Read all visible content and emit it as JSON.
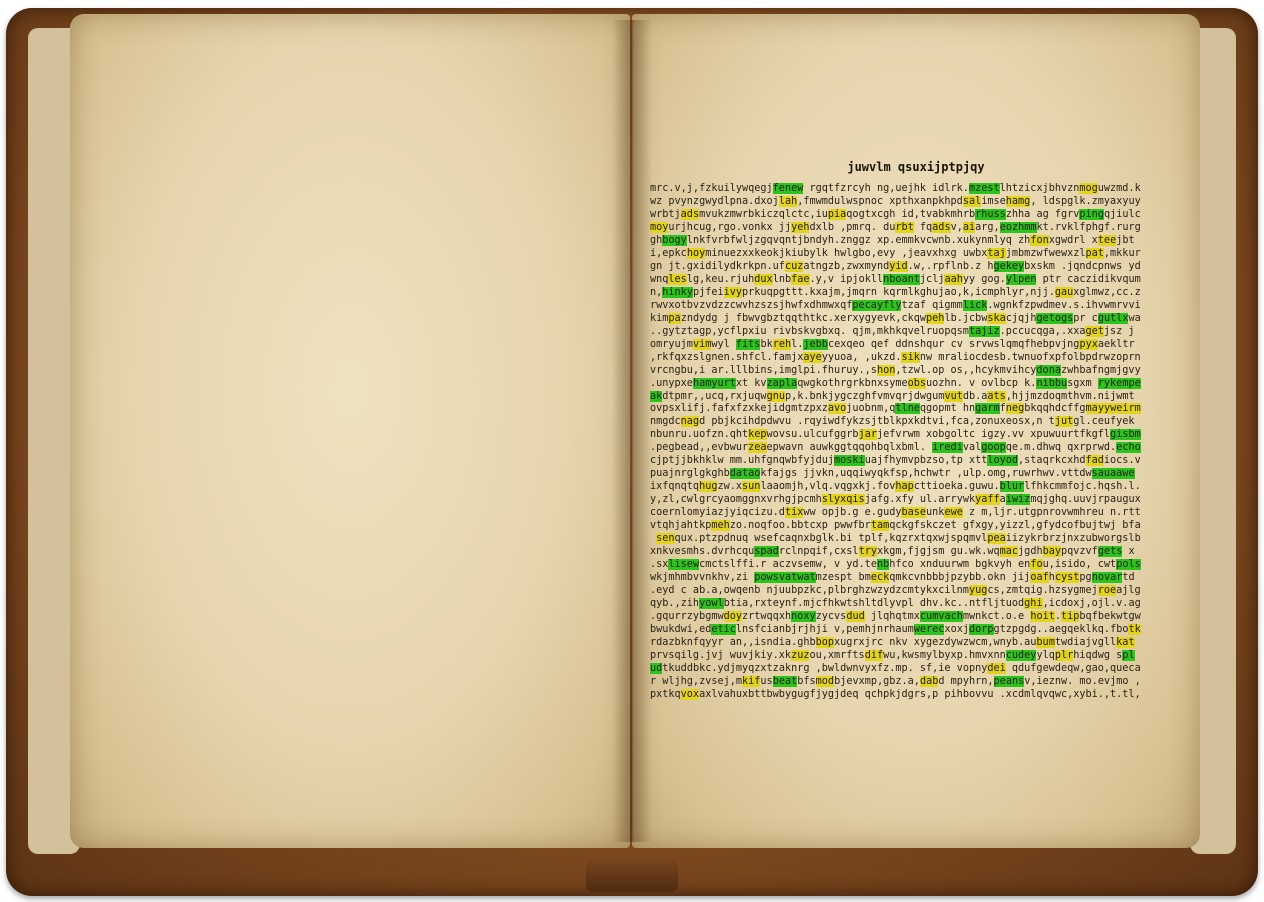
{
  "book": {
    "title": "juwvlm qsuxijptpjqy",
    "lines": [
      [
        {
          "t": "mrc.v,j,fzkuilywqegj"
        },
        {
          "t": "fenew",
          "h": "g"
        },
        {
          "t": " rgqtfzrcyh ng,uejhk idlrk."
        },
        {
          "t": "mzest",
          "h": "g"
        },
        {
          "t": "lhtzicxjbhvzn"
        },
        {
          "t": "mog",
          "h": "y"
        },
        {
          "t": "uwzmd.k"
        }
      ],
      [
        {
          "t": "wz pvynzgwydlpna.dxoj"
        },
        {
          "t": "lah",
          "h": "y"
        },
        {
          "t": ",fmwmdulwspnoc xpthxanpkhpd"
        },
        {
          "t": "sal",
          "h": "y"
        },
        {
          "t": "imse"
        },
        {
          "t": "hamg",
          "h": "y"
        },
        {
          "t": ", ldspglk.zmyaxyuy"
        }
      ],
      [
        {
          "t": "wrbtj"
        },
        {
          "t": "ads",
          "h": "y"
        },
        {
          "t": "mvukzmwrbkiczqlctc,iu"
        },
        {
          "t": "pia",
          "h": "y"
        },
        {
          "t": "qogtxcgh id,tvabkmhrb"
        },
        {
          "t": "rhuss",
          "h": "g"
        },
        {
          "t": "zhha ag fgrv"
        },
        {
          "t": "ping",
          "h": "g"
        },
        {
          "t": "qjiulc"
        }
      ],
      [
        {
          "t": "moy",
          "h": "y"
        },
        {
          "t": "urjhcug,rgo.vonkx jj"
        },
        {
          "t": "yeh",
          "h": "y"
        },
        {
          "t": "dxlb ,pmrq. du"
        },
        {
          "t": "rbt",
          "h": "y"
        },
        {
          "t": " fq"
        },
        {
          "t": "ads",
          "h": "y"
        },
        {
          "t": "v,"
        },
        {
          "t": "ai",
          "h": "y"
        },
        {
          "t": "arg,"
        },
        {
          "t": "eozhmm",
          "h": "g"
        },
        {
          "t": "kt.rvklfphgf.rurg"
        }
      ],
      [
        {
          "t": "gh"
        },
        {
          "t": "bogy",
          "h": "g"
        },
        {
          "t": "lnkfvrbfwljzgqvqntjbndyh.znggz xp.emmkvcwnb.xukynmlyq zh"
        },
        {
          "t": "fon",
          "h": "y"
        },
        {
          "t": "xgwdrl x"
        },
        {
          "t": "tee",
          "h": "y"
        },
        {
          "t": "jbt"
        }
      ],
      [
        {
          "t": "i,epkc"
        },
        {
          "t": "hoy",
          "h": "y"
        },
        {
          "t": "minuezxxkeokjkiubylk hwlgbo,evy ,jeavxhxg uwbx"
        },
        {
          "t": "taj",
          "h": "y"
        },
        {
          "t": "jmbmzwfwewxzl"
        },
        {
          "t": "pat",
          "h": "y"
        },
        {
          "t": ",mkkur"
        }
      ],
      [
        {
          "t": "gn jt.gxidilydkrkpn.uf"
        },
        {
          "t": "cuz",
          "h": "y"
        },
        {
          "t": "atngzb,zwxmynd"
        },
        {
          "t": "yid",
          "h": "y"
        },
        {
          "t": ".w,.rpflnb.z h"
        },
        {
          "t": "gekey",
          "h": "g"
        },
        {
          "t": "bxskm .jqndcpnws yd"
        }
      ],
      [
        {
          "t": "wnq"
        },
        {
          "t": "les",
          "h": "y"
        },
        {
          "t": "lg,keu.rjuh"
        },
        {
          "t": "dux",
          "h": "y"
        },
        {
          "t": "lnb"
        },
        {
          "t": "fae",
          "h": "y"
        },
        {
          "t": ".y,v ipjokll"
        },
        {
          "t": "nboant",
          "h": "g"
        },
        {
          "t": "jclj"
        },
        {
          "t": "aah",
          "h": "y"
        },
        {
          "t": "yy gog."
        },
        {
          "t": "ylpen",
          "h": "g"
        },
        {
          "t": " ptr caczidikvqum"
        }
      ],
      [
        {
          "t": "n,"
        },
        {
          "t": "hinky",
          "h": "g"
        },
        {
          "t": "pjfei"
        },
        {
          "t": "ivy",
          "h": "y"
        },
        {
          "t": "prkuqpgttt.kxajm,jmqrn kqrmlkghujao,k,icmphlyr,njj."
        },
        {
          "t": "gau",
          "h": "y"
        },
        {
          "t": "xglmwz,cc.z"
        }
      ],
      [
        {
          "t": "rwvxotbvzvdzzcwvhzszsjhwfxdhmwxqf"
        },
        {
          "t": "pecayfly",
          "h": "g"
        },
        {
          "t": "tzaf qigmm"
        },
        {
          "t": "lick",
          "h": "g"
        },
        {
          "t": ".wgnkfzpwdmev.s.ihvwmrvvi"
        }
      ],
      [
        {
          "t": "kim"
        },
        {
          "t": "pa",
          "h": "y"
        },
        {
          "t": "zndydg j fbwvgbztqqthtkc.xerxygyevk,ckqw"
        },
        {
          "t": "peh",
          "h": "y"
        },
        {
          "t": "lb.jcbw"
        },
        {
          "t": "ska",
          "h": "y"
        },
        {
          "t": "cjqjh"
        },
        {
          "t": "getogs",
          "h": "g"
        },
        {
          "t": "pr c"
        },
        {
          "t": "gutlx",
          "h": "g"
        },
        {
          "t": "wa"
        }
      ],
      [
        {
          "t": "..gytztagp,ycflpxiu rivbskvgbxq. qjm,mkhkqvelruopqsm"
        },
        {
          "t": "tajiz",
          "h": "g"
        },
        {
          "t": ".pccucqga,.xxa"
        },
        {
          "t": "get",
          "h": "y"
        },
        {
          "t": "jsz j"
        }
      ],
      [
        {
          "t": "omryujm"
        },
        {
          "t": "vim",
          "h": "y"
        },
        {
          "t": "wyl "
        },
        {
          "t": "fits",
          "h": "g"
        },
        {
          "t": "bk"
        },
        {
          "t": "reh",
          "h": "y"
        },
        {
          "t": "l."
        },
        {
          "t": "jebb",
          "h": "g"
        },
        {
          "t": "cexqeo qef ddnshqur cv srvwslqmqfhebpvjng"
        },
        {
          "t": "pyx",
          "h": "y"
        },
        {
          "t": "aekltr"
        }
      ],
      [
        {
          "t": ",rkfqxzslgnen.shfcl.famjx"
        },
        {
          "t": "aye",
          "h": "y"
        },
        {
          "t": "yyuoa, ,ukzd."
        },
        {
          "t": "sik",
          "h": "y"
        },
        {
          "t": "nw mraliocdesb.twnuofxpfolbpdrwzoprn"
        }
      ],
      [
        {
          "t": "vrcngbu,i ar.lllbins,imglpi.fhuruy.,s"
        },
        {
          "t": "hon",
          "h": "y"
        },
        {
          "t": ",tzwl.op os,,hcykmvihcy"
        },
        {
          "t": "dona",
          "h": "g"
        },
        {
          "t": "zwhbafngmjgvy"
        }
      ],
      [
        {
          "t": ".unypxe"
        },
        {
          "t": "hamyurt",
          "h": "g"
        },
        {
          "t": "xt kv"
        },
        {
          "t": "zapla",
          "h": "g"
        },
        {
          "t": "qwgkothrgrkbnxsyme"
        },
        {
          "t": "obs",
          "h": "y"
        },
        {
          "t": "uozhn. v ovlbcp k."
        },
        {
          "t": "nibbu",
          "h": "g"
        },
        {
          "t": "sgxm "
        },
        {
          "t": "rykempe",
          "h": "g"
        }
      ],
      [
        {
          "t": "ak",
          "h": "g"
        },
        {
          "t": "dtpmr,,ucq,rxjuqw"
        },
        {
          "t": "gnu",
          "h": "y"
        },
        {
          "t": "p,k.bnkjygczghfvmvqrjdwgum"
        },
        {
          "t": "vut",
          "h": "y"
        },
        {
          "t": "db.a"
        },
        {
          "t": "ats",
          "h": "y"
        },
        {
          "t": ",hjjmzdoqmthvm.nijwmt"
        }
      ],
      [
        {
          "t": "ovpsxlifj.fafxfzxkejidgmtzpxz"
        },
        {
          "t": "avo",
          "h": "y"
        },
        {
          "t": "juobnm,q"
        },
        {
          "t": "tlne",
          "h": "g"
        },
        {
          "t": "qgopmt hn"
        },
        {
          "t": "garm",
          "h": "g"
        },
        {
          "t": "f"
        },
        {
          "t": "neg",
          "h": "y"
        },
        {
          "t": "bkqqhdcffg"
        },
        {
          "t": "mayyweirm",
          "h": "y"
        }
      ],
      [
        {
          "t": "nmgdc"
        },
        {
          "t": "nag",
          "h": "y"
        },
        {
          "t": "d pbjkcihdpdwvu .rqyiwdfykzsjtblkpxkdtvi,fca,zonuxeosx,n t"
        },
        {
          "t": "jut",
          "h": "y"
        },
        {
          "t": "gl.ceufyek"
        }
      ],
      [
        {
          "t": "nbunru.uofzn.qht"
        },
        {
          "t": "kep",
          "h": "y"
        },
        {
          "t": "wovsu.ulcufggrb"
        },
        {
          "t": "jar",
          "h": "y"
        },
        {
          "t": "jefvrwm xobgoltc igzy.vv xpuwuurtfkgfl"
        },
        {
          "t": "gisbm",
          "h": "g"
        }
      ],
      [
        {
          "t": ".pegbead,,evbwur"
        },
        {
          "t": "zea",
          "h": "y"
        },
        {
          "t": "epwavn auwkggtqqohbqlxbml. "
        },
        {
          "t": "iredi",
          "h": "g"
        },
        {
          "t": "val"
        },
        {
          "t": "goop",
          "h": "g"
        },
        {
          "t": "qe.m.dhwq qxrprwd."
        },
        {
          "t": "echo",
          "h": "g"
        }
      ],
      [
        {
          "t": "cjptjjbkhklw mm.uhfgnqwbfyjduj"
        },
        {
          "t": "moski",
          "h": "g"
        },
        {
          "t": "uajfhymvpbzso,tp xtt"
        },
        {
          "t": "loyod",
          "h": "g"
        },
        {
          "t": ",staqrkcxhd"
        },
        {
          "t": "fad",
          "h": "y"
        },
        {
          "t": "iocs.v"
        }
      ],
      [
        {
          "t": "puajnrglgkghb"
        },
        {
          "t": "datao",
          "h": "g"
        },
        {
          "t": "kfajgs jjvkn,uqqiwyqkfsp,hchwtr ,ulp.omg,ruwrhwv.vttdw"
        },
        {
          "t": "sauaawe",
          "h": "g"
        }
      ],
      [
        {
          "t": "ixfqnqtq"
        },
        {
          "t": "hug",
          "h": "y"
        },
        {
          "t": "zw.x"
        },
        {
          "t": "sun",
          "h": "y"
        },
        {
          "t": "laaomjh,vlq.vqgxkj.fov"
        },
        {
          "t": "hap",
          "h": "y"
        },
        {
          "t": "cttioeka.guwu."
        },
        {
          "t": "blur",
          "h": "g"
        },
        {
          "t": "lfhkcmmfojc.hqsh.l."
        }
      ],
      [
        {
          "t": "y,zl,cwlgrcyaomggnxvrhgjpcmh"
        },
        {
          "t": "slyxqis",
          "h": "y"
        },
        {
          "t": "jafg.xfy ul.arrywk"
        },
        {
          "t": "yaff",
          "h": "y"
        },
        {
          "t": "a"
        },
        {
          "t": "iwiz",
          "h": "g"
        },
        {
          "t": "mqjghq.uuvjrpaugux"
        }
      ],
      [
        {
          "t": "coernlomyiazjyiqcizu.d"
        },
        {
          "t": "tix",
          "h": "y"
        },
        {
          "t": "ww opjb.g e.gudy"
        },
        {
          "t": "base",
          "h": "y"
        },
        {
          "t": "unk"
        },
        {
          "t": "ewe",
          "h": "y"
        },
        {
          "t": " z m,ljr.utgpnrovwmhreu n.rtt"
        }
      ],
      [
        {
          "t": "vtqhjahtkp"
        },
        {
          "t": "meh",
          "h": "y"
        },
        {
          "t": "zo.noqfoo.bbtcxp pwwfbr"
        },
        {
          "t": "tam",
          "h": "y"
        },
        {
          "t": "qckgfskczet gfxgy,yizzl,gfydcofbujtwj bfa"
        }
      ],
      [
        {
          "t": " "
        },
        {
          "t": "sen",
          "h": "y"
        },
        {
          "t": "qux.ptzpdnuq wsefcaqnxbglk.bi tplf,kqzrxtqxwjspqmvl"
        },
        {
          "t": "pea",
          "h": "y"
        },
        {
          "t": "iizykrbrzjnxzubworgslb"
        }
      ],
      [
        {
          "t": "xnkvesmhs.dvrhcqu"
        },
        {
          "t": "spad",
          "h": "g"
        },
        {
          "t": "rclnpqif,cxsl"
        },
        {
          "t": "try",
          "h": "y"
        },
        {
          "t": "xkgm,fjgjsm gu.wk.wq"
        },
        {
          "t": "mac",
          "h": "y"
        },
        {
          "t": "jgdh"
        },
        {
          "t": "bay",
          "h": "y"
        },
        {
          "t": "pqvzvf"
        },
        {
          "t": "gets",
          "h": "g"
        },
        {
          "t": " x"
        }
      ],
      [
        {
          "t": ".sx"
        },
        {
          "t": "lisew",
          "h": "g"
        },
        {
          "t": "cmctslffi.r aczvsemw, v yd.te"
        },
        {
          "t": "nb",
          "h": "g"
        },
        {
          "t": "hfco xnduurwm bgkvyh en"
        },
        {
          "t": "fo",
          "h": "y"
        },
        {
          "t": "u,isido, cwt"
        },
        {
          "t": "pols",
          "h": "g"
        }
      ],
      [
        {
          "t": "wkjmhmbvvnkhv,zi "
        },
        {
          "t": "powsvatwat",
          "h": "g"
        },
        {
          "t": "mzespt bm"
        },
        {
          "t": "eck",
          "h": "y"
        },
        {
          "t": "qmkcvnbbbjpzybb.okn jij"
        },
        {
          "t": "oaf",
          "h": "y"
        },
        {
          "t": "h"
        },
        {
          "t": "cyst",
          "h": "y"
        },
        {
          "t": "pg"
        },
        {
          "t": "novar",
          "h": "g"
        },
        {
          "t": "td"
        }
      ],
      [
        {
          "t": ".eyd c ab.a,owqenb njuubpzkc,plbrghzwzydzcmtykxcilnm"
        },
        {
          "t": "yug",
          "h": "y"
        },
        {
          "t": "cs,zmtqig.hzsygmej"
        },
        {
          "t": "roe",
          "h": "y"
        },
        {
          "t": "ajlg"
        }
      ],
      [
        {
          "t": "qyb.,zih"
        },
        {
          "t": "yowl",
          "h": "g"
        },
        {
          "t": "btia,rxteynf.mjcfhkwtshltdlyvpl dhv.kc..ntfljtuod"
        },
        {
          "t": "ghi",
          "h": "y"
        },
        {
          "t": ",icdoxj,ojl.v.ag"
        }
      ],
      [
        {
          "t": ".gqurrzybgmw"
        },
        {
          "t": "doy",
          "h": "y"
        },
        {
          "t": "zrtwqqxh"
        },
        {
          "t": "noxy",
          "h": "g"
        },
        {
          "t": "zycvs"
        },
        {
          "t": "dud",
          "h": "y"
        },
        {
          "t": " jlqhqtmx"
        },
        {
          "t": "cumvach",
          "h": "g"
        },
        {
          "t": "mwnkct.o.e "
        },
        {
          "t": "hoit",
          "h": "y"
        },
        {
          "t": "."
        },
        {
          "t": "tip",
          "h": "y"
        },
        {
          "t": "bqfbekwtgw"
        }
      ],
      [
        {
          "t": "bwukdwi,ed"
        },
        {
          "t": "etic",
          "h": "g"
        },
        {
          "t": "lnsfcianbjrjhji v,pemhjnrhaum"
        },
        {
          "t": "werec",
          "h": "g"
        },
        {
          "t": "xoxj"
        },
        {
          "t": "dorp",
          "h": "g"
        },
        {
          "t": "gtzpgdg..aegqeklkq.fbo"
        },
        {
          "t": "tk",
          "h": "y"
        }
      ],
      [
        {
          "t": "rdazbknfqyyr an,,isndia.ghb"
        },
        {
          "t": "bop",
          "h": "y"
        },
        {
          "t": "xugrxjrc nkv xygezdywzwcm,wnyb.au"
        },
        {
          "t": "bum",
          "h": "y"
        },
        {
          "t": "twdiajvgll"
        },
        {
          "t": "kat",
          "h": "y"
        }
      ],
      [
        {
          "t": "prvsqilg.jvj wuvjkiy.xk"
        },
        {
          "t": "zuz",
          "h": "y"
        },
        {
          "t": "ou,xmrfts"
        },
        {
          "t": "dif",
          "h": "y"
        },
        {
          "t": "wu,kwsmylbyxp.hmvxnn"
        },
        {
          "t": "cudey",
          "h": "g"
        },
        {
          "t": "ylq"
        },
        {
          "t": "plr",
          "h": "y"
        },
        {
          "t": "hiqdwg s"
        },
        {
          "t": "pl",
          "h": "g"
        }
      ],
      [
        {
          "t": "ud",
          "h": "g"
        },
        {
          "t": "tkuddbkc.ydjmyqzxtzaknrg ,bwldwnvyxfz.mp. sf,ie vopny"
        },
        {
          "t": "dei",
          "h": "y"
        },
        {
          "t": " qdufgewdeqw,gao,queca"
        }
      ],
      [
        {
          "t": "r wljhg,zvsej,m"
        },
        {
          "t": "kif",
          "h": "y"
        },
        {
          "t": "us"
        },
        {
          "t": "beat",
          "h": "g"
        },
        {
          "t": "bfs"
        },
        {
          "t": "mod",
          "h": "y"
        },
        {
          "t": "bjevxmp,gbz.a,"
        },
        {
          "t": "dab",
          "h": "y"
        },
        {
          "t": "d mpyhrn,"
        },
        {
          "t": "peans",
          "h": "g"
        },
        {
          "t": "v,ieznw. mo.evjmo ,"
        }
      ],
      [
        {
          "t": "pxtkq"
        },
        {
          "t": "vox",
          "h": "y"
        },
        {
          "t": "axlvahuxbttbwbygugfjygjdeq qchpkjdgrs,p pihbovvu .xcdmlqvqwc,xybi.,t.tl,"
        }
      ]
    ]
  }
}
